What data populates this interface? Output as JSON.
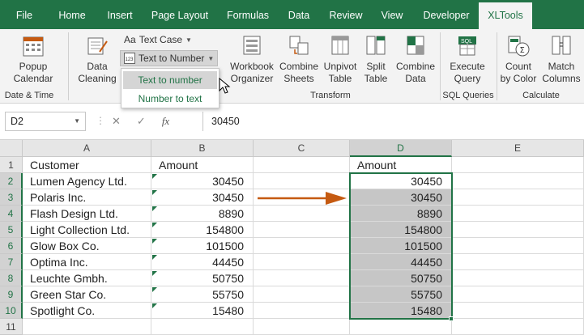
{
  "tabs": [
    {
      "label": "File",
      "active": false
    },
    {
      "label": "Home",
      "active": false
    },
    {
      "label": "Insert",
      "active": false
    },
    {
      "label": "Page Layout",
      "active": false
    },
    {
      "label": "Formulas",
      "active": false
    },
    {
      "label": "Data",
      "active": false
    },
    {
      "label": "Review",
      "active": false
    },
    {
      "label": "View",
      "active": false
    },
    {
      "label": "Developer",
      "active": false
    },
    {
      "label": "XLTools",
      "active": true
    }
  ],
  "ribbon": {
    "popup_calendar": "Popup\nCalendar",
    "date_time_group": "Date & Time",
    "data_cleaning": "Data\nCleaning",
    "text_case": "Text Case",
    "text_to_number": "Text to Number",
    "workbook_organizer": "Workbook\nOrganizer",
    "combine_sheets": "Combine\nSheets",
    "unpivot_table": "Unpivot\nTable",
    "split_table": "Split\nTable",
    "combine_data": "Combine\nData",
    "transform_group": "Transform",
    "execute_query": "Execute\nQuery",
    "sql_group": "SQL Queries",
    "count_by_color": "Count\nby Color",
    "match_columns": "Match\nColumns",
    "calculate_group": "Calculate"
  },
  "menu": {
    "items": [
      "Text to number",
      "Number to text"
    ]
  },
  "formula_bar": {
    "name_box": "D2",
    "cancel": "✕",
    "enter": "✓",
    "fx": "fx",
    "value": "30450"
  },
  "grid": {
    "columns": [
      "A",
      "B",
      "C",
      "D",
      "E"
    ],
    "rows": [
      "1",
      "2",
      "3",
      "4",
      "5",
      "6",
      "7",
      "8",
      "9",
      "10",
      "11"
    ],
    "headers": {
      "a": "Customer",
      "b": "Amount",
      "d": "Amount"
    },
    "data": [
      {
        "customer": "Lumen Agency Ltd.",
        "amount_b": "30450",
        "amount_d": "30450"
      },
      {
        "customer": "Polaris Inc.",
        "amount_b": "30450",
        "amount_d": "30450"
      },
      {
        "customer": "Flash Design Ltd.",
        "amount_b": "8890",
        "amount_d": "8890"
      },
      {
        "customer": "Light Collection Ltd.",
        "amount_b": "154800",
        "amount_d": "154800"
      },
      {
        "customer": "Glow Box Co.",
        "amount_b": "101500",
        "amount_d": "101500"
      },
      {
        "customer": "Optima Inc.",
        "amount_b": "44450",
        "amount_d": "44450"
      },
      {
        "customer": "Leuchte Gmbh.",
        "amount_b": "50750",
        "amount_d": "50750"
      },
      {
        "customer": "Green Star Co.",
        "amount_b": "55750",
        "amount_d": "55750"
      },
      {
        "customer": "Spotlight Co.",
        "amount_b": "15480",
        "amount_d": "15480"
      }
    ]
  },
  "colors": {
    "accent": "#217346",
    "arrow": "#c55a11",
    "selection": "#c6c6c6"
  }
}
